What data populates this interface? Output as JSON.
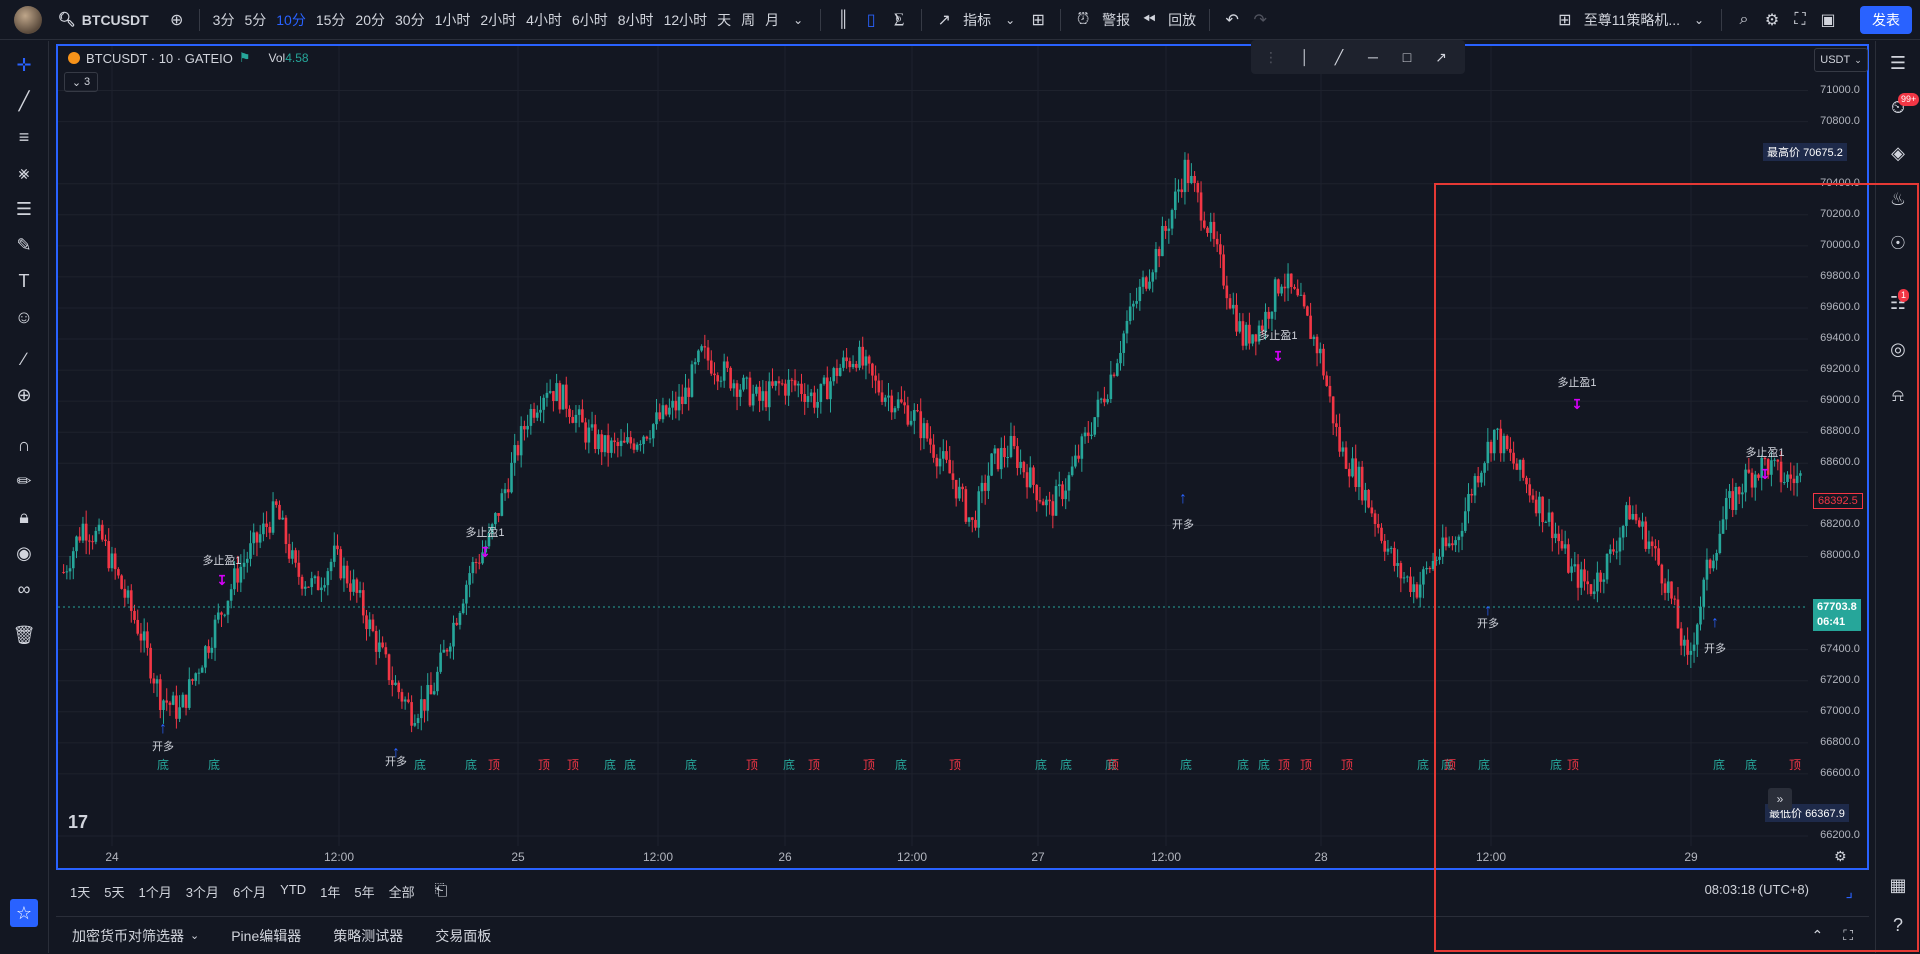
{
  "topbar": {
    "symbol": "BTCUSDT",
    "intervals": [
      "3分",
      "5分",
      "10分",
      "15分",
      "20分",
      "30分",
      "1小时",
      "2小时",
      "4小时",
      "6小时",
      "8小时",
      "12小时",
      "天",
      "周",
      "月"
    ],
    "active_interval": "10分",
    "indicators_label": "指标",
    "alert_label": "警报",
    "replay_label": "回放",
    "layout_name": "至尊11策略机...",
    "publish_label": "发表"
  },
  "legend": {
    "title": "BTCUSDT · 10 · GATEIO",
    "vol_label": "Vol",
    "vol_value": "4.58",
    "collapse_count": "3"
  },
  "currency": "USDT",
  "price_axis": [
    "71000.0",
    "70800.0",
    "70400.0",
    "70200.0",
    "70000.0",
    "69800.0",
    "69600.0",
    "69400.0",
    "69200.0",
    "69000.0",
    "68800.0",
    "68600.0",
    "68200.0",
    "68000.0",
    "67400.0",
    "67200.0",
    "67000.0",
    "66800.0",
    "66600.0",
    "66200.0"
  ],
  "price_tags": {
    "high_label": "最高价",
    "high_value": "70675.2",
    "low_label": "最低价",
    "low_value": "66367.9",
    "last_price": "67703.8",
    "countdown": "06:41",
    "line_price": "68392.5"
  },
  "time_axis": [
    "24",
    "12:00",
    "25",
    "12:00",
    "26",
    "12:00",
    "27",
    "12:00",
    "28",
    "12:00",
    "29"
  ],
  "annotations": {
    "open_long": "开多",
    "take_profit": "多止盈1",
    "bottom": "底",
    "top": "顶"
  },
  "ranges": [
    "1天",
    "5天",
    "1个月",
    "3个月",
    "6个月",
    "YTD",
    "1年",
    "5年",
    "全部"
  ],
  "clock": "08:03:18 (UTC+8)",
  "panels": [
    "加密货币对筛选器",
    "Pine编辑器",
    "策略测试器",
    "交易面板"
  ],
  "badges": {
    "notifications": "99+",
    "chat": "1"
  },
  "colors": {
    "bg": "#131722",
    "up": "#26a69a",
    "down": "#f23645",
    "accent": "#2962ff",
    "signal": "#d500f9"
  },
  "chart_data": {
    "type": "candlestick",
    "series_close": [
      67900,
      68200,
      68100,
      67800,
      67500,
      67100,
      67000,
      67300,
      67600,
      67900,
      68100,
      68300,
      67900,
      67800,
      68000,
      67800,
      67500,
      67200,
      67000,
      67100,
      67500,
      67900,
      68100,
      68500,
      68900,
      69100,
      69000,
      68800,
      68700,
      68700,
      68800,
      68900,
      69000,
      69300,
      69200,
      69100,
      69000,
      69100,
      69100,
      69000,
      69200,
      69300,
      69100,
      69000,
      68900,
      68700,
      68500,
      68200,
      68600,
      68700,
      68500,
      68300,
      68500,
      68800,
      69100,
      69500,
      69800,
      70100,
      70500,
      70200,
      69800,
      69400,
      69500,
      69800,
      69600,
      69300,
      68700,
      68500,
      68200,
      67900,
      67800,
      68000,
      68100,
      68500,
      68800,
      68600,
      68400,
      68200,
      67900,
      67800,
      68000,
      68300,
      68100,
      67800,
      67300,
      67900,
      68300,
      68500,
      68600,
      68500
    ],
    "ylim": [
      66200,
      71100
    ]
  }
}
